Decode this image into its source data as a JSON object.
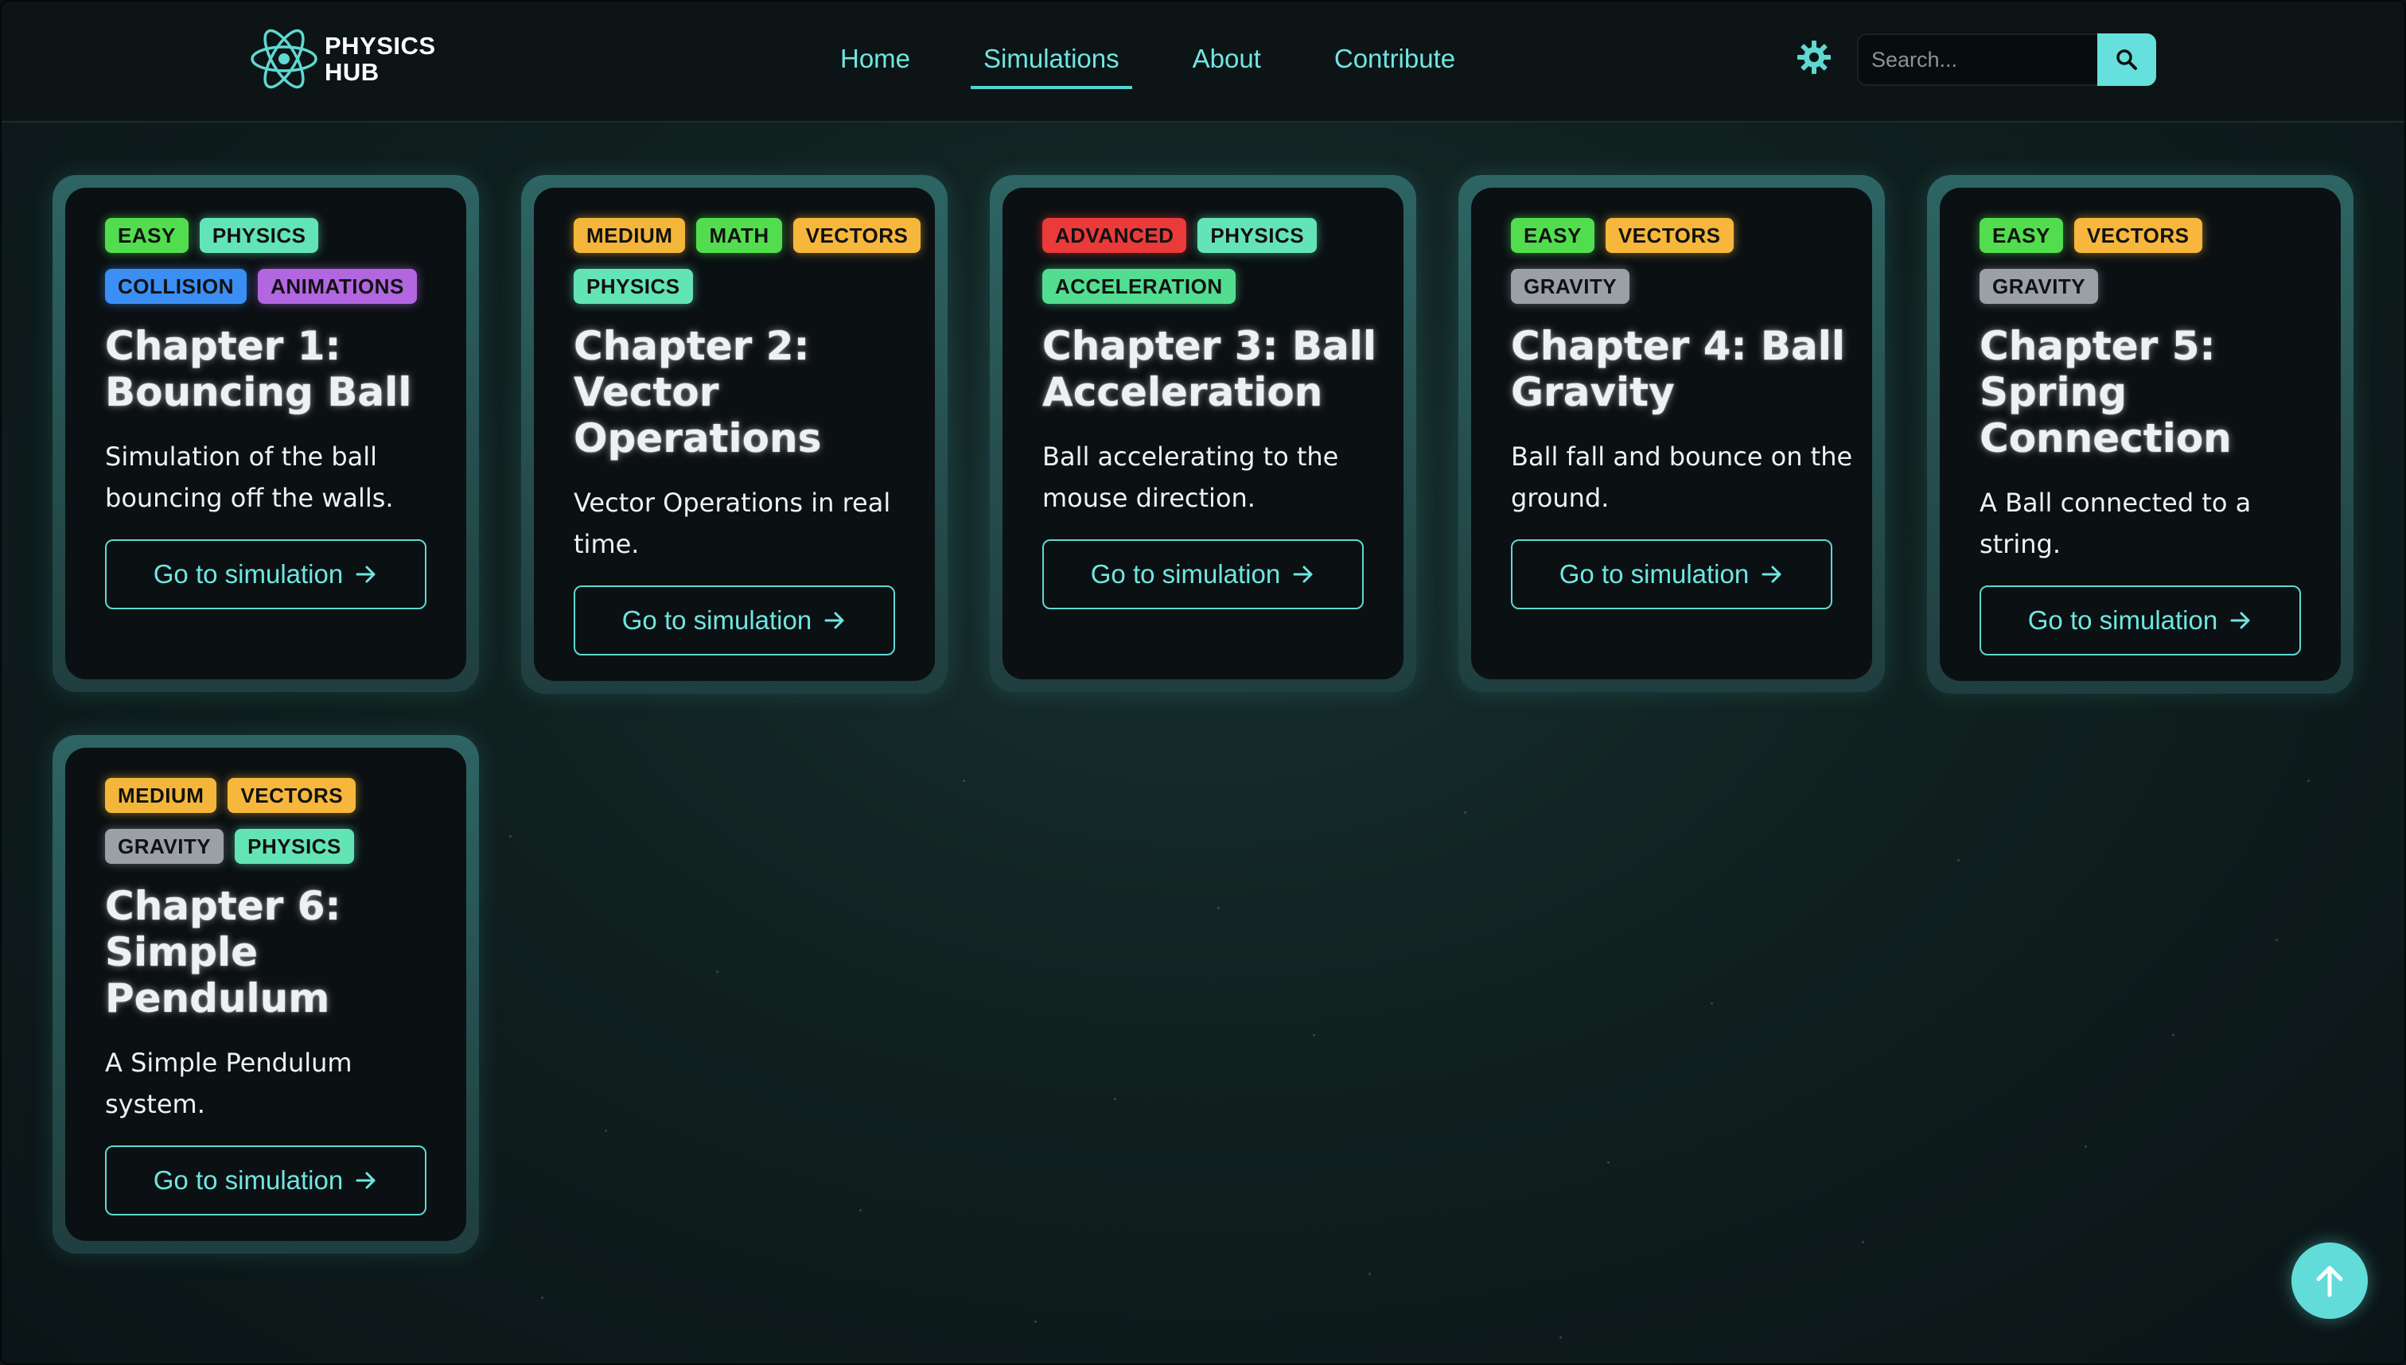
{
  "brand": {
    "line1": "PHYSICS",
    "line2": "HUB"
  },
  "nav": [
    {
      "label": "Home",
      "active": false
    },
    {
      "label": "Simulations",
      "active": true
    },
    {
      "label": "About",
      "active": false
    },
    {
      "label": "Contribute",
      "active": false
    }
  ],
  "search": {
    "placeholder": "Search...",
    "value": ""
  },
  "colors": {
    "accent": "#66e0dc",
    "background": "#10201f",
    "card": "#0b1013"
  },
  "icons": {
    "theme_toggle": "gear-icon",
    "search": "search-icon",
    "arrow": "arrow-right-icon",
    "scroll_top": "arrow-up-icon"
  },
  "button_label": "Go to simulation",
  "cards": [
    {
      "tags": [
        {
          "label": "EASY",
          "kind": "easy"
        },
        {
          "label": "PHYSICS",
          "kind": "physics"
        },
        {
          "label": "COLLISION",
          "kind": "collision"
        },
        {
          "label": "ANIMATIONS",
          "kind": "animations"
        }
      ],
      "title": "Chapter 1: Bouncing Ball",
      "description": "Simulation of the ball bouncing off the walls."
    },
    {
      "tags": [
        {
          "label": "MEDIUM",
          "kind": "medium"
        },
        {
          "label": "MATH",
          "kind": "math"
        },
        {
          "label": "VECTORS",
          "kind": "vectors"
        },
        {
          "label": "PHYSICS",
          "kind": "physics"
        }
      ],
      "title": "Chapter 2: Vector Operations",
      "description": "Vector Operations in real time."
    },
    {
      "tags": [
        {
          "label": "ADVANCED",
          "kind": "advanced"
        },
        {
          "label": "PHYSICS",
          "kind": "physics"
        },
        {
          "label": "ACCELERATION",
          "kind": "acceleration"
        }
      ],
      "title": "Chapter 3: Ball Acceleration",
      "description": "Ball accelerating to the mouse direction."
    },
    {
      "tags": [
        {
          "label": "EASY",
          "kind": "easy"
        },
        {
          "label": "VECTORS",
          "kind": "vectors"
        },
        {
          "label": "GRAVITY",
          "kind": "gravity"
        }
      ],
      "title": "Chapter 4: Ball Gravity",
      "description": "Ball fall and bounce on the ground."
    },
    {
      "tags": [
        {
          "label": "EASY",
          "kind": "easy"
        },
        {
          "label": "VECTORS",
          "kind": "vectors"
        },
        {
          "label": "GRAVITY",
          "kind": "gravity"
        }
      ],
      "title": "Chapter 5: Spring Connection",
      "description": "A Ball connected to a string."
    },
    {
      "tags": [
        {
          "label": "MEDIUM",
          "kind": "medium"
        },
        {
          "label": "VECTORS",
          "kind": "vectors"
        },
        {
          "label": "GRAVITY",
          "kind": "gravity"
        },
        {
          "label": "PHYSICS",
          "kind": "physics"
        }
      ],
      "title": "Chapter 6: Simple Pendulum",
      "description": "A Simple Pendulum system."
    }
  ]
}
